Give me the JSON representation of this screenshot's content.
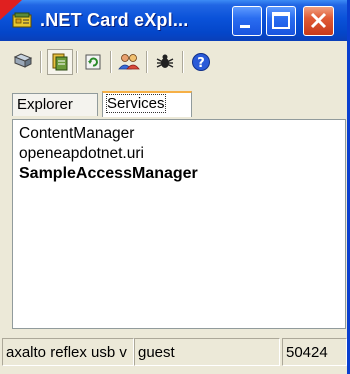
{
  "window": {
    "title": ".NET Card eXpl...",
    "app_icon": "card-reader-icon",
    "controls": {
      "minimize": "minimize-icon",
      "maximize": "maximize-icon",
      "close": "close-icon"
    }
  },
  "toolbar": {
    "items": [
      {
        "icon": "connect-icon",
        "pressed": false
      },
      {
        "icon": "bookmark-icon",
        "pressed": true
      },
      {
        "icon": "refresh-icon",
        "pressed": false
      },
      {
        "icon": "users-icon",
        "pressed": false
      },
      {
        "icon": "debug-icon",
        "pressed": false
      },
      {
        "icon": "help-icon",
        "pressed": false
      }
    ]
  },
  "tabs": [
    {
      "label": "Explorer",
      "active": false
    },
    {
      "label": "Services",
      "active": true
    }
  ],
  "services": [
    {
      "name": "ContentManager",
      "bold": false
    },
    {
      "name": "openeapdotnet.uri",
      "bold": false
    },
    {
      "name": "SampleAccessManager",
      "bold": true
    }
  ],
  "statusbar": {
    "reader": "axalto reflex usb v",
    "user": "guest",
    "port": "50424"
  },
  "colors": {
    "titlebar": "#0a52d9",
    "close_button": "#e05a35",
    "active_tab_accent": "#f6b046"
  }
}
